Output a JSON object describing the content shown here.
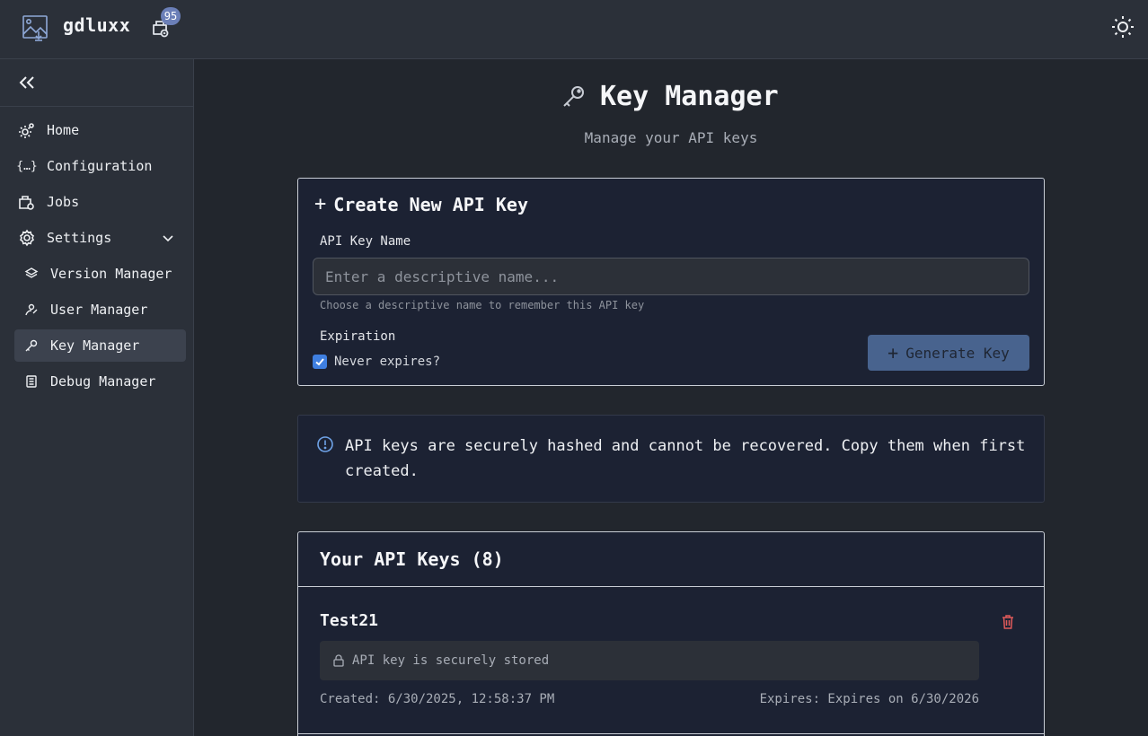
{
  "app": {
    "name": "gdluxx",
    "jobs_badge": "95"
  },
  "sidebar": {
    "items": [
      {
        "label": "Home",
        "icon": "gear-icon"
      },
      {
        "label": "Configuration",
        "icon": "braces-icon"
      },
      {
        "label": "Jobs",
        "icon": "jobs-icon"
      },
      {
        "label": "Settings",
        "icon": "settings-icon"
      },
      {
        "label": "Version Manager",
        "icon": "layers-icon"
      },
      {
        "label": "User Manager",
        "icon": "user-icon"
      },
      {
        "label": "Key Manager",
        "icon": "key-icon"
      },
      {
        "label": "Debug Manager",
        "icon": "document-icon"
      }
    ],
    "active": "Key Manager"
  },
  "main": {
    "title": "Key Manager",
    "subtitle": "Manage your API keys",
    "create": {
      "title": "Create New API Key",
      "name_label": "API Key Name",
      "name_placeholder": "Enter a descriptive name...",
      "name_value": "",
      "hint": "Choose a descriptive name to remember this API key",
      "expiration_label": "Expiration",
      "never_expires_label": "Never expires?",
      "never_expires_checked": true,
      "generate_label": "Generate Key"
    },
    "info": "API keys are securely hashed and cannot be recovered. Copy them when first created.",
    "keys": {
      "title": "Your API Keys (8)",
      "items": [
        {
          "name": "Test21",
          "status": "API key is securely stored",
          "created": "Created: 6/30/2025, 12:58:37 PM",
          "expires": "Expires: Expires on 6/30/2026"
        }
      ]
    }
  },
  "colors": {
    "accent": "#3f7fe0",
    "button": "#48638e",
    "danger": "#e05a5a",
    "info": "#6fa3e8"
  }
}
